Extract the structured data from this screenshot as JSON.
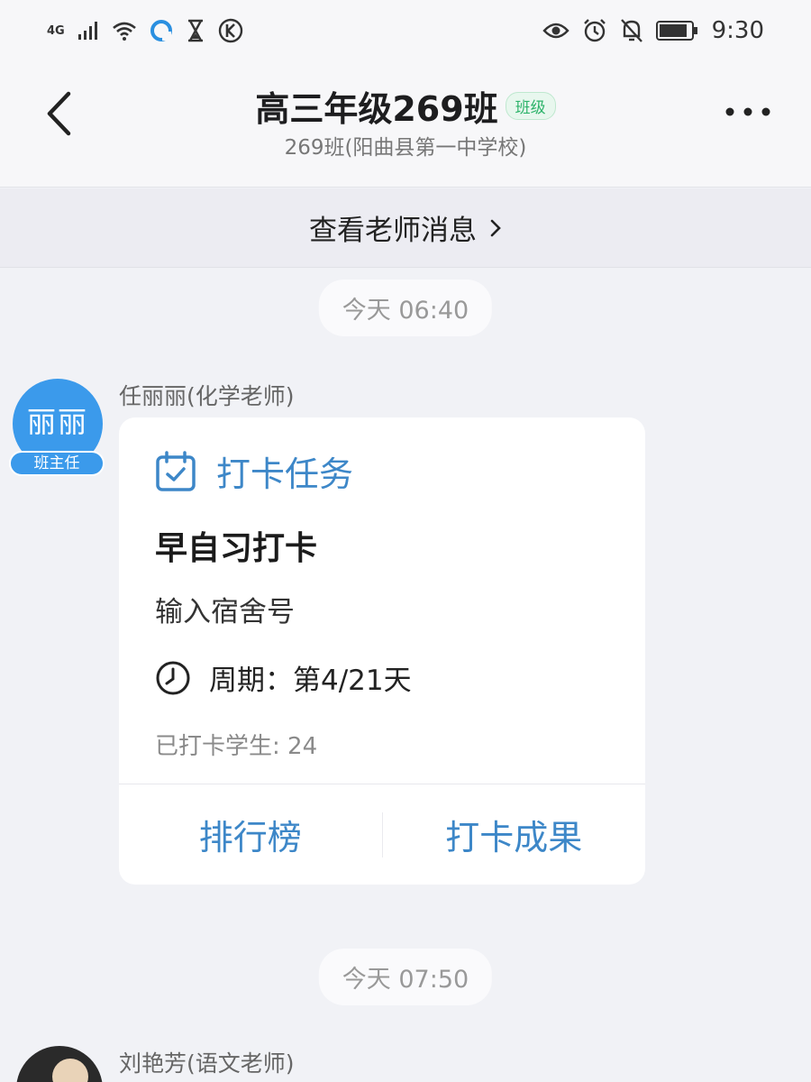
{
  "status_bar": {
    "network": "4G",
    "time": "9:30"
  },
  "header": {
    "title": "高三年级269班",
    "badge": "班级",
    "subtitle": "269班(阳曲县第一中学校)"
  },
  "teacher_bar": {
    "label": "查看老师消息"
  },
  "messages": [
    {
      "time": "今天 06:40",
      "sender": "任丽丽(化学老师)",
      "avatar_text": "丽丽",
      "avatar_role": "班主任",
      "card": {
        "type": "打卡任务",
        "title": "早自习打卡",
        "desc": "输入宿舍号",
        "period": "周期：第4/21天",
        "count": "已打卡学生: 24",
        "actions": [
          "排行榜",
          "打卡成果"
        ]
      }
    },
    {
      "time": "今天 07:50",
      "sender": "刘艳芳(语文老师)"
    }
  ],
  "colors": {
    "accent": "#3d87c8",
    "avatar_bg": "#3b9aeb",
    "badge_green": "#2db36a"
  },
  "icons": {
    "back": "chevron-left-icon",
    "more": "more-dots-icon",
    "calendar": "calendar-check-icon",
    "clock": "clock-icon"
  }
}
